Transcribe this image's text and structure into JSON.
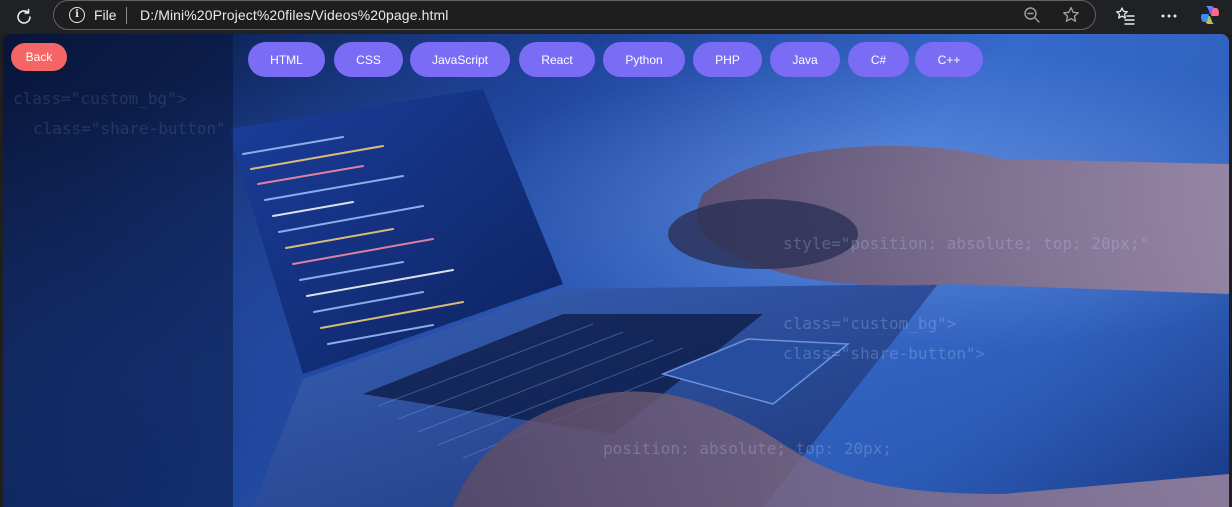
{
  "browser": {
    "scheme_label": "File",
    "url": "D:/Mini%20Project%20files/Videos%20page.html",
    "icons": [
      "reload-icon",
      "info-icon",
      "zoom-out-icon",
      "favorite-star-icon",
      "favorites-list-icon",
      "more-options-icon",
      "copilot-icon"
    ]
  },
  "page": {
    "back_label": "Back",
    "tabs": [
      {
        "label": "HTML"
      },
      {
        "label": "CSS"
      },
      {
        "label": "JavaScript"
      },
      {
        "label": "React"
      },
      {
        "label": "Python"
      },
      {
        "label": "PHP"
      },
      {
        "label": "Java"
      },
      {
        "label": "C#"
      },
      {
        "label": "C++"
      }
    ]
  },
  "colors": {
    "back_button": "#f56565",
    "tab_button": "#7b6cf6",
    "browser_chrome": "#202124"
  }
}
